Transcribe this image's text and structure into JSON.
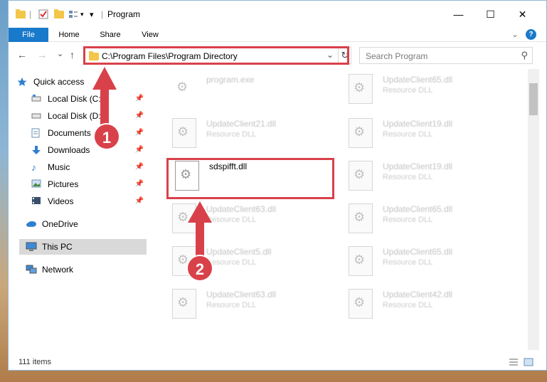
{
  "window": {
    "title": "Program",
    "controls": {
      "minimize": "—",
      "maximize": "☐",
      "close": "✕"
    }
  },
  "quick_access_toolbar": {
    "dropdown": "▾",
    "separator": "|"
  },
  "ribbon": {
    "tabs": [
      "File",
      "Home",
      "Share",
      "View"
    ],
    "expand": "⌄",
    "help": "?"
  },
  "navigation": {
    "back": "←",
    "forward": "→",
    "recent": "⌄",
    "up": "↑",
    "address": "C:\\Program Files\\Program Directory",
    "address_dropdown": "⌄",
    "refresh": "↻",
    "search_placeholder": "Search Program",
    "search_icon": "⚲"
  },
  "sidebar": {
    "quick_access": "Quick access",
    "items": [
      {
        "label": "Local Disk (C:)",
        "icon": "drive-icon",
        "pinned": true
      },
      {
        "label": "Local Disk (D:)",
        "icon": "drive-icon",
        "pinned": true
      },
      {
        "label": "Documents",
        "icon": "documents-icon",
        "pinned": true
      },
      {
        "label": "Downloads",
        "icon": "download-icon",
        "pinned": true
      },
      {
        "label": "Music",
        "icon": "music-icon",
        "pinned": true
      },
      {
        "label": "Pictures",
        "icon": "pictures-icon",
        "pinned": true
      },
      {
        "label": "Videos",
        "icon": "videos-icon",
        "pinned": true
      }
    ],
    "onedrive": "OneDrive",
    "this_pc": "This PC",
    "network": "Network",
    "pin_glyph": "📌"
  },
  "files": [
    {
      "name": "program.exe",
      "type": ""
    },
    {
      "name": "UpdateClient65.dll",
      "type": "Resource DLL"
    },
    {
      "name": "UpdateClient21.dll",
      "type": "Resource DLL"
    },
    {
      "name": "UpdateClient19.dll",
      "type": "Resource DLL"
    },
    {
      "name": "sdspifft.dll",
      "type": ""
    },
    {
      "name": "UpdateClient19.dll",
      "type": "Resource DLL"
    },
    {
      "name": "UpdateClient63.dll",
      "type": "Resource DLL"
    },
    {
      "name": "UpdateClient65.dll",
      "type": "Resource DLL"
    },
    {
      "name": "UpdateClient5.dll",
      "type": "Resource DLL"
    },
    {
      "name": "UpdateClient65.dll",
      "type": "Resource DLL"
    },
    {
      "name": "UpdateClient63.dll",
      "type": "Resource DLL"
    },
    {
      "name": "UpdateClient42.dll",
      "type": "Resource DLL"
    }
  ],
  "status": {
    "item_count": "111 items"
  },
  "annotations": {
    "step1": "1",
    "step2": "2",
    "color": "#d9414a"
  }
}
